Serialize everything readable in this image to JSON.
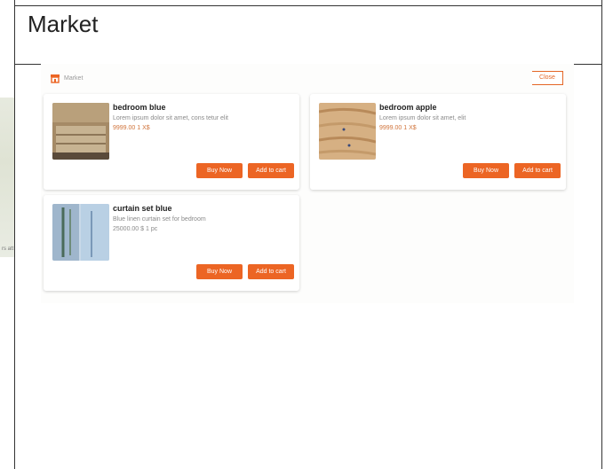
{
  "page": {
    "title": "Market"
  },
  "left_thumbnail": {
    "caption": "rs att"
  },
  "panel": {
    "header_label": "Market",
    "close_label": "Close"
  },
  "products": [
    {
      "name": "bedroom blue",
      "description": "Lorem ipsum dolor sit amet, cons tetur elit",
      "price": "9999.00 1 X$",
      "buy_label": "Buy Now",
      "cart_label": "Add to cart",
      "photo": "wooden-furniture-photo"
    },
    {
      "name": "bedroom apple",
      "description": "Lorem ipsum dolor sit amet, elit",
      "price": "9999.00 1 X$",
      "buy_label": "Buy Now",
      "cart_label": "Add to cart",
      "photo": "wood-panel-photo"
    },
    {
      "name": "curtain set blue",
      "description": "Blue linen curtain set for bedroom",
      "price": "25000.00 $ 1 pc",
      "buy_label": "Buy Now",
      "cart_label": "Add to cart",
      "photo": "curtain-photo"
    }
  ],
  "colors": {
    "accent": "#ec6524",
    "price": "#d0733a"
  }
}
